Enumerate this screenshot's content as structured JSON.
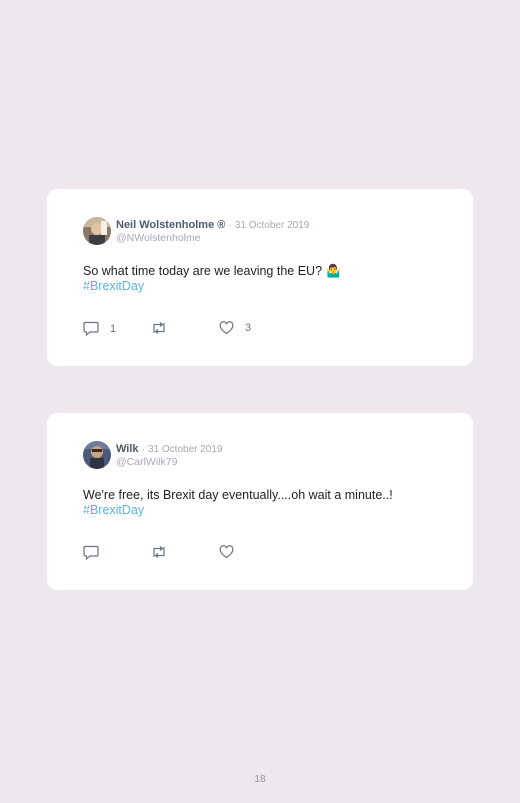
{
  "tweets": [
    {
      "name": "Neil Wolstenholme ®",
      "date": "31 October 2019",
      "handle": "@NWolstenholme",
      "text": "So what time today are we leaving the EU? 🤷‍♂️",
      "hashtag": "#BrexitDay",
      "reply_count": "1",
      "like_count": "3"
    },
    {
      "name": "Wilk",
      "date": "31 October 2019",
      "handle": "@CarlWilk79",
      "text": "We're free, its Brexit day eventually....oh wait a minute..!",
      "hashtag": "#BrexitDay",
      "reply_count": "",
      "like_count": ""
    }
  ],
  "separator": "·",
  "page_number": "18",
  "colors": {
    "background": "#efe7ee",
    "card": "#ffffff",
    "hashtag": "#5ab3e6",
    "meta": "#a4aab4"
  },
  "icons": [
    "reply-icon",
    "retweet-icon",
    "like-icon"
  ]
}
